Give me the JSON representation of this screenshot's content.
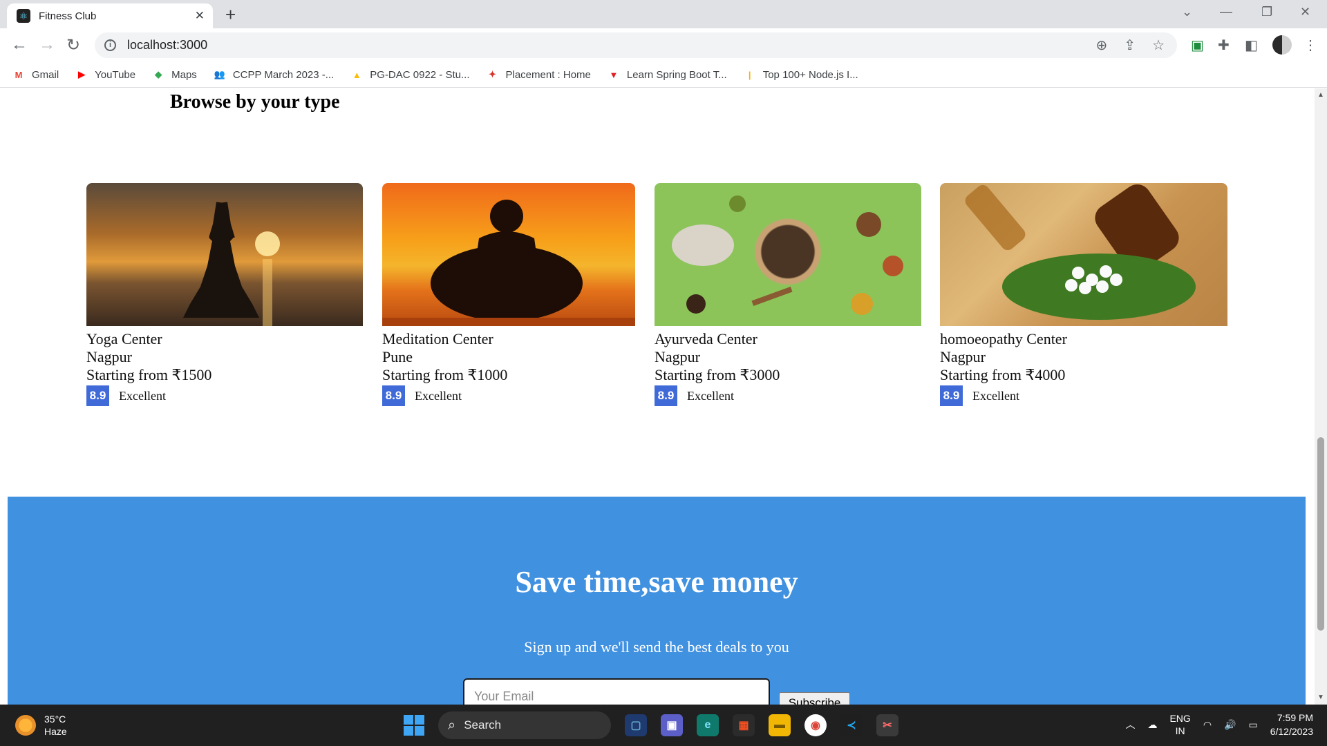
{
  "browser": {
    "tab_title": "Fitness Club",
    "tab_close": "✕",
    "new_tab": "+",
    "url": "localhost:3000",
    "bookmarks": [
      {
        "label": "Gmail",
        "icon": "gmail-icon",
        "glyph": "M",
        "color": "#ea4335"
      },
      {
        "label": "YouTube",
        "icon": "youtube-icon",
        "glyph": "▶",
        "color": "#ff0000"
      },
      {
        "label": "Maps",
        "icon": "maps-icon",
        "glyph": "◆",
        "color": "#34a853"
      },
      {
        "label": "CCPP March 2023 -...",
        "icon": "people-icon",
        "glyph": "👥",
        "color": "#4285f4"
      },
      {
        "label": "PG-DAC 0922 - Stu...",
        "icon": "drive-icon",
        "glyph": "▲",
        "color": "#fbbc04"
      },
      {
        "label": "Placement : Home",
        "icon": "runner-icon",
        "glyph": "✦",
        "color": "#d93025"
      },
      {
        "label": "Learn Spring Boot T...",
        "icon": "triangle-icon",
        "glyph": "▼",
        "color": "#e11d21"
      },
      {
        "label": "Top 100+ Node.js I...",
        "icon": "bars-icon",
        "glyph": "|",
        "color": "#f4b400"
      }
    ]
  },
  "page": {
    "section_title": "Browse by your type",
    "cards": [
      {
        "name": "Yoga Center",
        "city": "Nagpur",
        "price": "Starting from ₹1500",
        "score": "8.9",
        "rating": "Excellent",
        "image": "yoga-sunset-image"
      },
      {
        "name": "Meditation Center",
        "city": "Pune",
        "price": "Starting from ₹1000",
        "score": "8.9",
        "rating": "Excellent",
        "image": "meditation-sunset-image"
      },
      {
        "name": "Ayurveda Center",
        "city": "Nagpur",
        "price": "Starting from ₹3000",
        "score": "8.9",
        "rating": "Excellent",
        "image": "ayurveda-herbs-image"
      },
      {
        "name": "homoeopathy Center",
        "city": "Nagpur",
        "price": "Starting from ₹4000",
        "score": "8.9",
        "rating": "Excellent",
        "image": "homoeopathy-pills-image"
      }
    ],
    "signup": {
      "title": "Save time,save money",
      "subtitle": "Sign up and we'll send the best deals to you",
      "email_placeholder": "Your Email",
      "button": "Subscribe"
    },
    "colors": {
      "accent": "#4191e1",
      "badge": "#3f6ad8"
    }
  },
  "taskbar": {
    "weather_temp": "35°C",
    "weather_desc": "Haze",
    "search": "Search",
    "lang_top": "ENG",
    "lang_bottom": "IN",
    "time": "7:59 PM",
    "date": "6/12/2023"
  }
}
